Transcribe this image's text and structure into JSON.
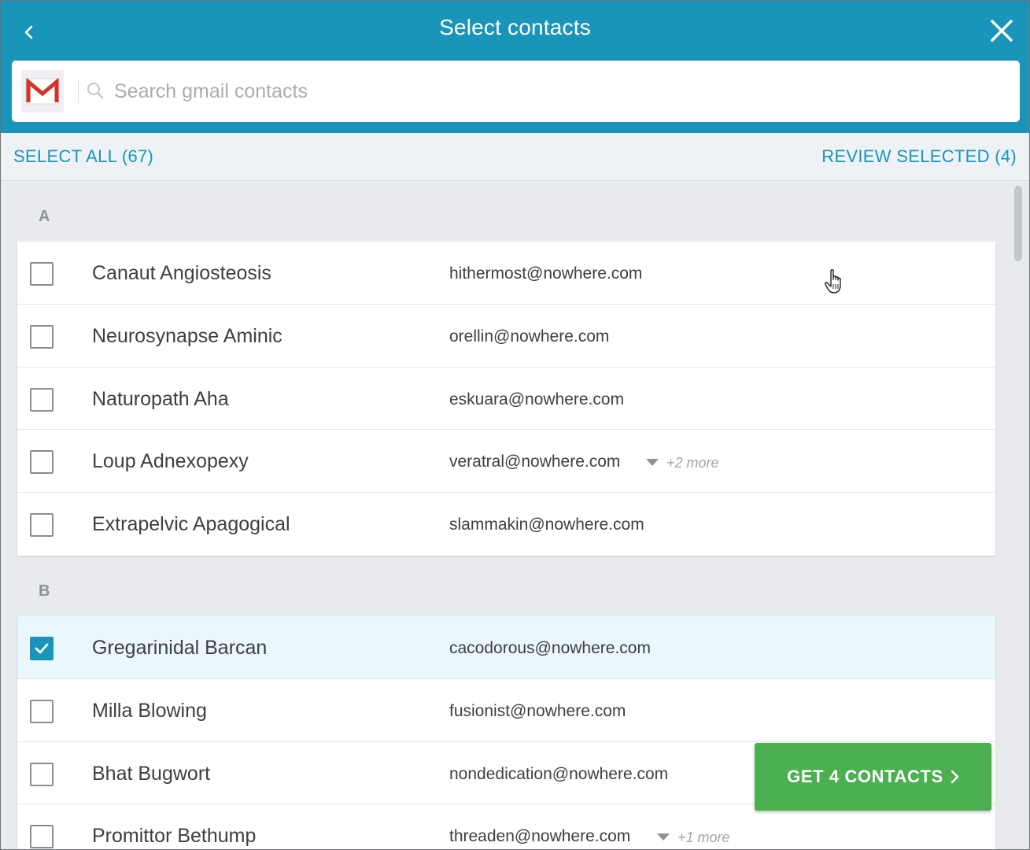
{
  "header": {
    "title": "Select contacts"
  },
  "search": {
    "placeholder": "Search gmail contacts",
    "value": ""
  },
  "toolbar": {
    "select_all_label": "SELECT ALL (67)",
    "review_selected_label": "REVIEW SELECTED (4)"
  },
  "sections": [
    {
      "letter": "A",
      "contacts": [
        {
          "name": "Canaut Angiosteosis",
          "email": "hithermost@nowhere.com",
          "more": "",
          "checked": false
        },
        {
          "name": "Neurosynapse Aminic",
          "email": "orellin@nowhere.com",
          "more": "",
          "checked": false
        },
        {
          "name": "Naturopath Aha",
          "email": "eskuara@nowhere.com",
          "more": "",
          "checked": false
        },
        {
          "name": "Loup Adnexopexy",
          "email": "veratral@nowhere.com",
          "more": "+2 more",
          "checked": false
        },
        {
          "name": "Extrapelvic Apagogical",
          "email": "slammakin@nowhere.com",
          "more": "",
          "checked": false
        }
      ]
    },
    {
      "letter": "B",
      "contacts": [
        {
          "name": "Gregarinidal Barcan",
          "email": "cacodorous@nowhere.com",
          "more": "",
          "checked": true
        },
        {
          "name": "Milla Blowing",
          "email": "fusionist@nowhere.com",
          "more": "",
          "checked": false
        },
        {
          "name": "Bhat Bugwort",
          "email": "nondedication@nowhere.com",
          "more": "",
          "checked": false
        },
        {
          "name": "Promittor Bethump",
          "email": "threaden@nowhere.com",
          "more": "+1 more",
          "checked": false
        }
      ]
    }
  ],
  "footer": {
    "get_contacts_label": "GET 4 CONTACTS"
  },
  "colors": {
    "brand": "#1895b9",
    "action": "#4caf50"
  },
  "icons": [
    "chevron-left-icon",
    "close-icon",
    "gmail-logo-icon",
    "search-icon",
    "check-icon",
    "dropdown-arrow-icon",
    "chevron-right-icon",
    "hand-cursor-icon"
  ]
}
